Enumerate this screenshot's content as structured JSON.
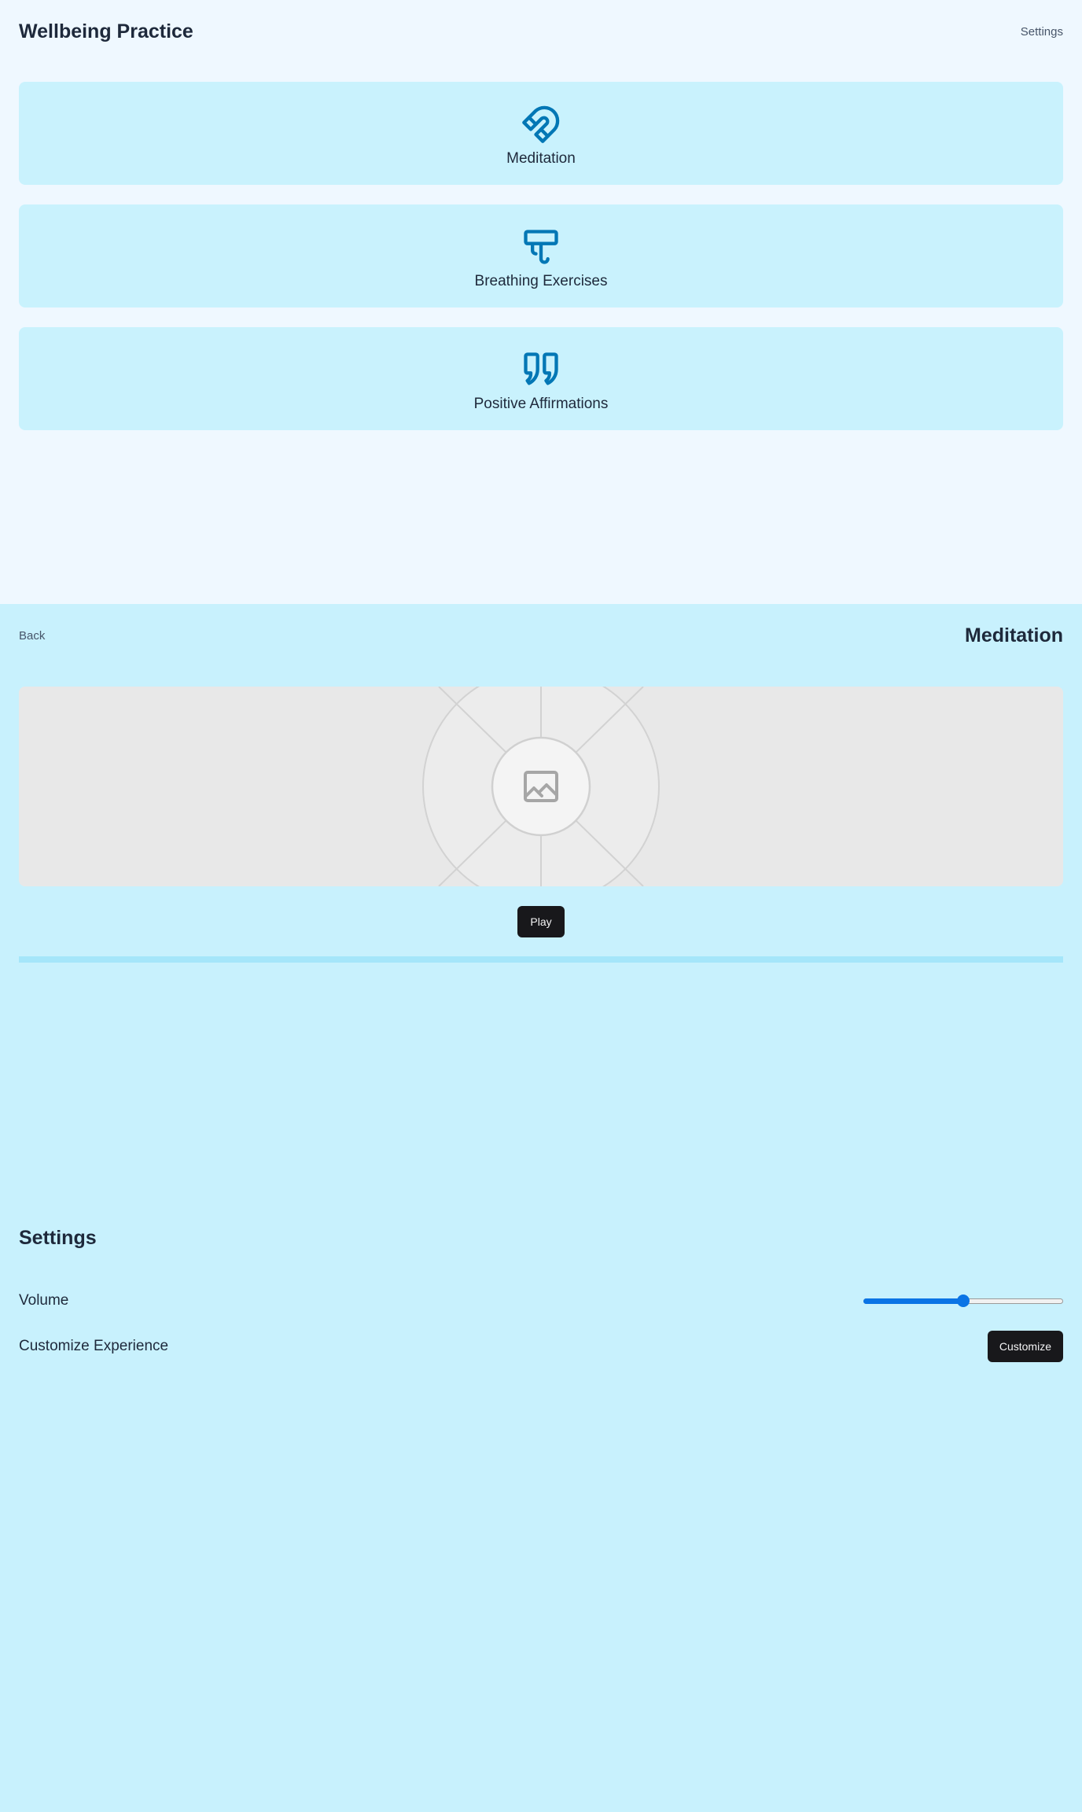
{
  "home": {
    "title": "Wellbeing Practice",
    "settings_link": "Settings",
    "cards": [
      {
        "label": "Meditation",
        "icon": "magnet-icon"
      },
      {
        "label": "Breathing Exercises",
        "icon": "wind-tap-icon"
      },
      {
        "label": "Positive Affirmations",
        "icon": "quote-icon"
      }
    ],
    "icon_color": "#0277b5"
  },
  "meditation": {
    "back_link": "Back",
    "title": "Meditation",
    "media_icon": "image-placeholder-icon",
    "play_label": "Play",
    "progress": 0
  },
  "settings": {
    "title": "Settings",
    "volume_label": "Volume",
    "volume_value": 0.5,
    "customize_label": "Customize Experience",
    "customize_button": "Customize"
  },
  "colors": {
    "home_bg": "#eff8ff",
    "screen_bg": "#c8f1fd",
    "card_bg": "#c9f2fd",
    "button_bg": "#18181b",
    "slider_accent": "#0b74e5"
  }
}
